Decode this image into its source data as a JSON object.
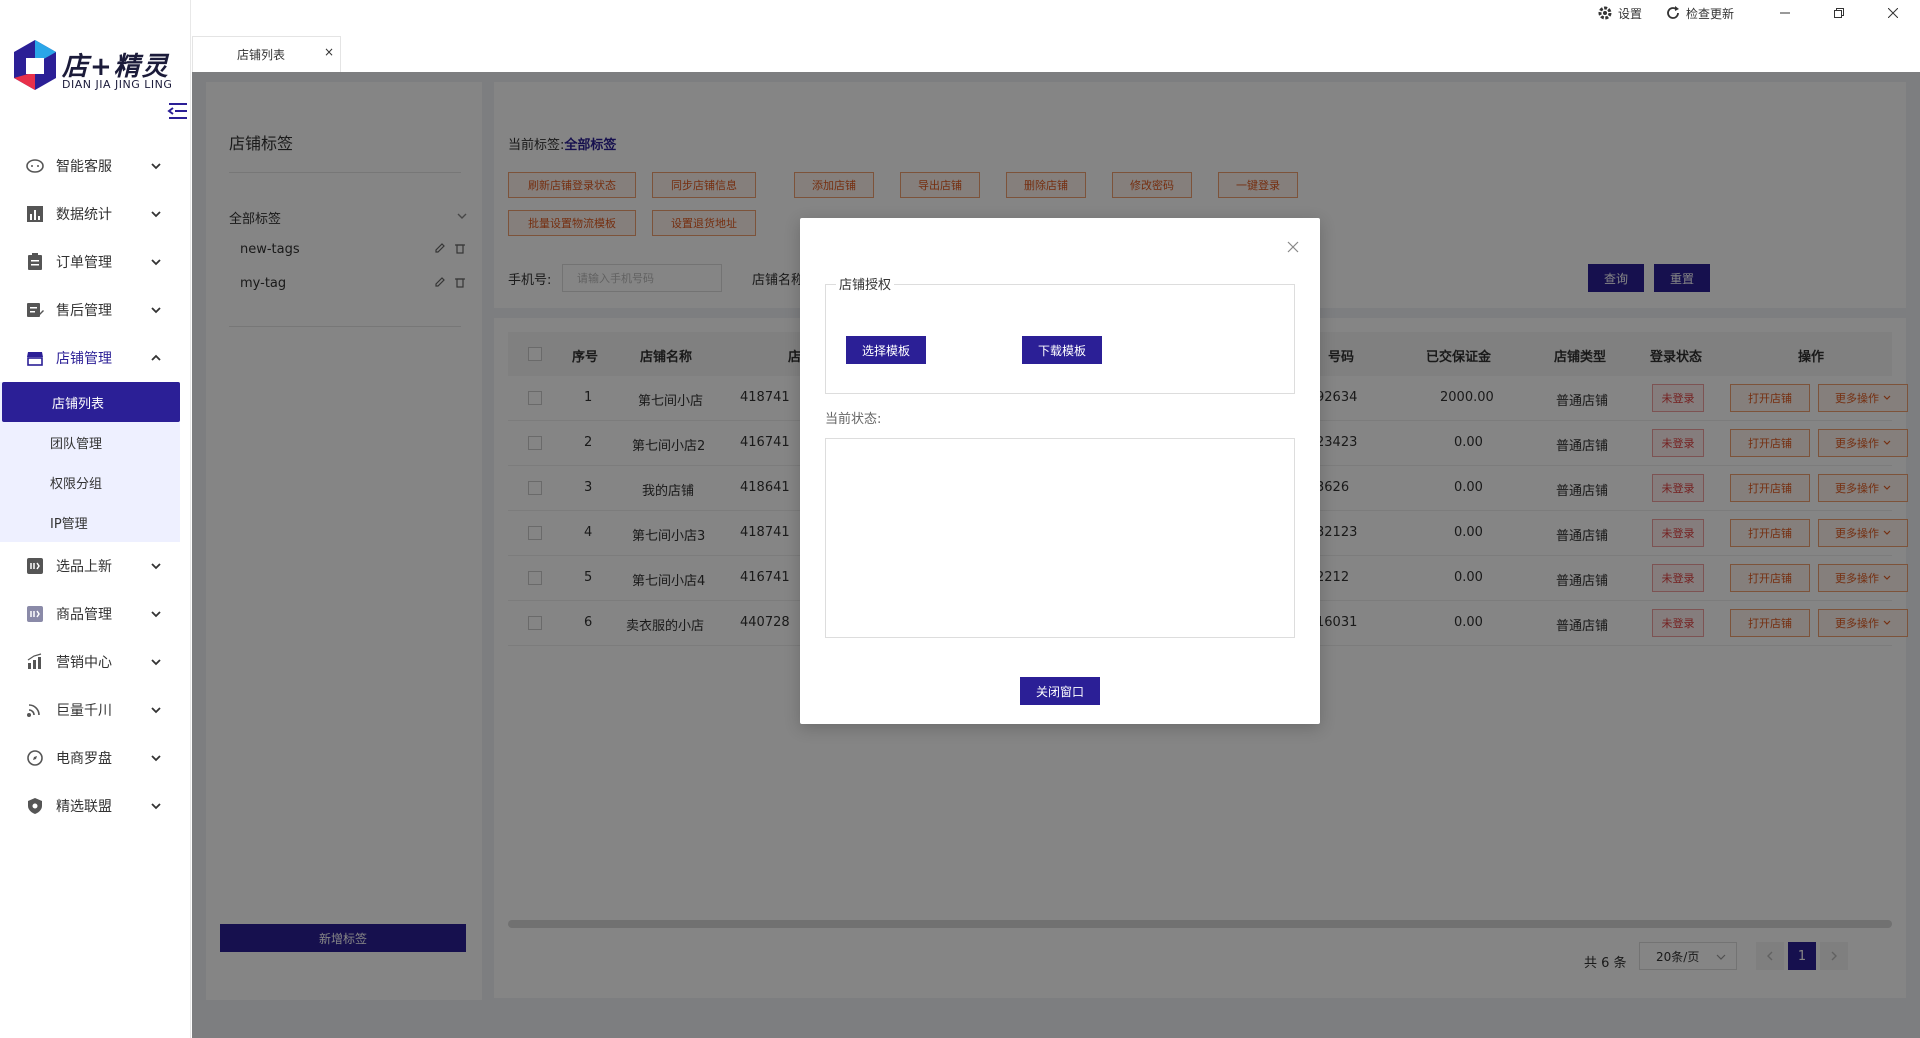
{
  "logo": {
    "text": "店+精灵",
    "sub": "DIAN JIA JING LING"
  },
  "sidebar": {
    "items": [
      {
        "label": "智能客服",
        "icon": "chat-icon"
      },
      {
        "label": "数据统计",
        "icon": "bar-chart-icon"
      },
      {
        "label": "订单管理",
        "icon": "clipboard-icon"
      },
      {
        "label": "售后管理",
        "icon": "edit-doc-icon"
      },
      {
        "label": "店铺管理",
        "icon": "store-icon",
        "expanded": true
      },
      {
        "label": "选品上新",
        "icon": "product-icon"
      },
      {
        "label": "商品管理",
        "icon": "goods-icon"
      },
      {
        "label": "营销中心",
        "icon": "marketing-icon"
      },
      {
        "label": "巨量千川",
        "icon": "signal-icon"
      },
      {
        "label": "电商罗盘",
        "icon": "compass-icon"
      },
      {
        "label": "精选联盟",
        "icon": "shield-icon"
      }
    ],
    "submenu": [
      {
        "label": "店铺列表",
        "active": true
      },
      {
        "label": "团队管理"
      },
      {
        "label": "权限分组"
      },
      {
        "label": "IP管理"
      }
    ]
  },
  "topbar": {
    "tab_label": "店铺列表",
    "tab_close": "×",
    "settings_label": "设置",
    "update_label": "检查更新"
  },
  "tags": {
    "title": "店铺标签",
    "all_label": "全部标签",
    "items": [
      "new-tags",
      "my-tag"
    ],
    "add_button": "新增标签"
  },
  "filter": {
    "current_tag_prefix": "当前标签:",
    "current_tag_value": "全部标签",
    "buttons_row1": [
      "刷新店铺登录状态",
      "同步店铺信息",
      "添加店铺",
      "导出店铺",
      "删除店铺",
      "修改密码",
      "一键登录"
    ],
    "buttons_row2": [
      "批量设置物流模板",
      "设置退货地址"
    ],
    "phone_label": "手机号:",
    "phone_placeholder": "请输入手机号码",
    "store_name_label": "店铺名称",
    "query_button": "查询",
    "reset_button": "重置"
  },
  "table": {
    "headers": [
      "序号",
      "店铺名称",
      "店",
      "号码",
      "已交保证金",
      "店铺类型",
      "登录状态",
      "操作"
    ],
    "rows": [
      {
        "no": "1",
        "name": "第七间小店",
        "id": "418741",
        "phone": "92634",
        "deposit": "2000.00",
        "type": "普通店铺",
        "status": "未登录"
      },
      {
        "no": "2",
        "name": "第七间小店2",
        "id": "416741",
        "phone": "23423",
        "deposit": "0.00",
        "type": "普通店铺",
        "status": "未登录"
      },
      {
        "no": "3",
        "name": "我的店铺",
        "id": "418641",
        "phone": "3626",
        "deposit": "0.00",
        "type": "普通店铺",
        "status": "未登录"
      },
      {
        "no": "4",
        "name": "第七间小店3",
        "id": "418741",
        "phone": "32123",
        "deposit": "0.00",
        "type": "普通店铺",
        "status": "未登录"
      },
      {
        "no": "5",
        "name": "第七间小店4",
        "id": "416741",
        "phone": "2212",
        "deposit": "0.00",
        "type": "普通店铺",
        "status": "未登录"
      },
      {
        "no": "6",
        "name": "卖衣服的小店",
        "id": "440728",
        "phone": "16031",
        "deposit": "0.00",
        "type": "普通店铺",
        "status": "未登录"
      }
    ],
    "open_store": "打开店铺",
    "more_actions": "更多操作"
  },
  "pager": {
    "total": "共 6 条",
    "page_size": "20条/页",
    "current": "1"
  },
  "modal": {
    "legend": "店铺授权",
    "select_template": "选择模板",
    "download_template": "下载模板",
    "status_label": "当前状态:",
    "close_button": "关闭窗口"
  },
  "colors": {
    "primary": "#2b1f96",
    "warn": "#e05a20",
    "danger": "#e04040"
  }
}
